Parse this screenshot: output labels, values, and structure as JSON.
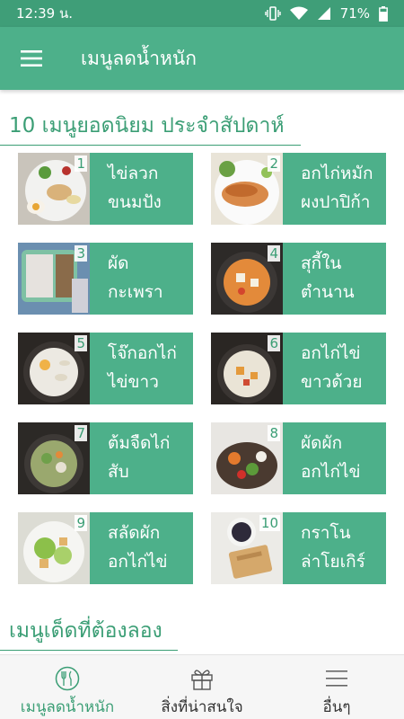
{
  "status_bar": {
    "time": "12:39 น.",
    "battery": "71%"
  },
  "app_bar": {
    "title": "เมนูลดน้ำหนัก"
  },
  "sections": [
    {
      "title": "10 เมนูยอดนิยม ประจำสัปดาห์"
    },
    {
      "title": "เมนูเด็ดที่ต้องลอง"
    }
  ],
  "menus": [
    {
      "num": "1",
      "line1": "ไข่ลวก",
      "line2": "ขนมปัง"
    },
    {
      "num": "2",
      "line1": "อกไก่หมัก",
      "line2": "ผงปาปิก้า"
    },
    {
      "num": "3",
      "line1": "ผัด",
      "line2": "กะเพรา"
    },
    {
      "num": "4",
      "line1": "สุกี้ใน",
      "line2": "ตำนาน"
    },
    {
      "num": "5",
      "line1": "โจ๊กอกไก่",
      "line2": "ไข่ขาว"
    },
    {
      "num": "6",
      "line1": "อกไก่ไข่",
      "line2": "ขาวด้วย"
    },
    {
      "num": "7",
      "line1": "ต้มจืดไก่",
      "line2": "สับ"
    },
    {
      "num": "8",
      "line1": "ผัดผัก",
      "line2": "อกไก่ไข่"
    },
    {
      "num": "9",
      "line1": "สลัดผัก",
      "line2": "อกไก่ไข่"
    },
    {
      "num": "10",
      "line1": "กราโน",
      "line2": "ล่าโยเกิร์"
    }
  ],
  "bottom_nav": {
    "items": [
      {
        "label": "เมนูลดน้ำหนัก"
      },
      {
        "label": "สิ่งที่น่าสนใจ"
      },
      {
        "label": "อื่นๆ"
      }
    ]
  },
  "colors": {
    "status_bar": "#3f9e78",
    "app_bar": "#4db08a",
    "accent_text": "#3b9e75",
    "card_label": "#4db08a",
    "nav_bg": "#f6f6f6"
  }
}
